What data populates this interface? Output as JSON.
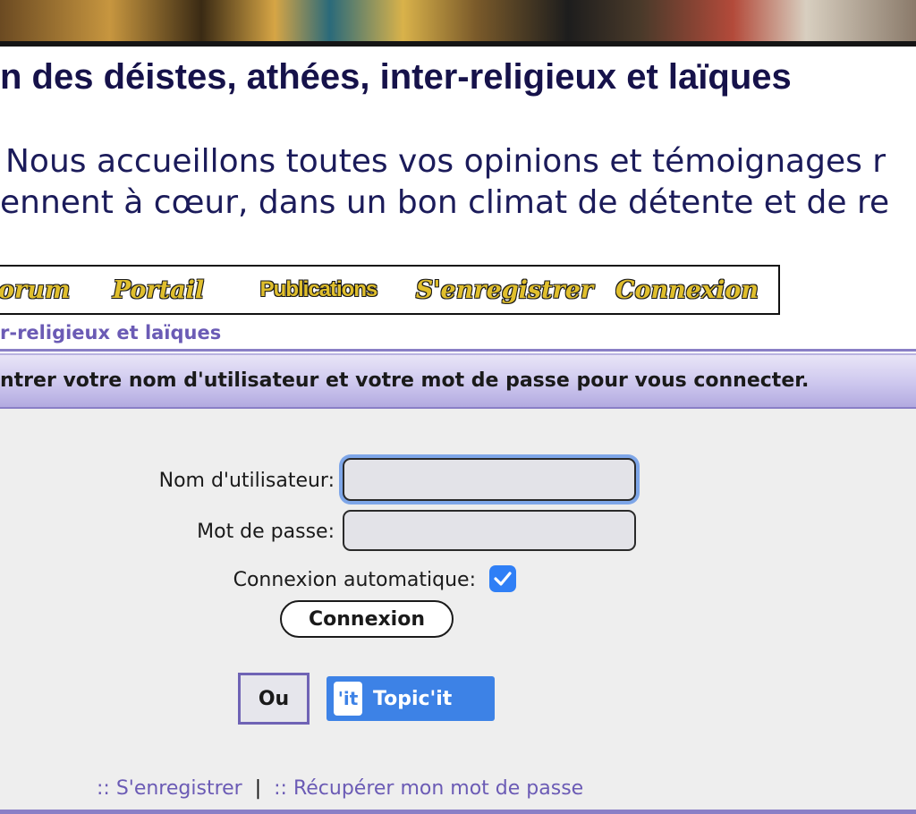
{
  "site": {
    "title": "n des déistes, athées, inter-religieux et laïques",
    "intro_line1": "Nous accueillons toutes vos opinions et témoignages r",
    "intro_line2": "ennent à cœur, dans un bon climat de détente et de re"
  },
  "nav": {
    "items": [
      {
        "label": "orum"
      },
      {
        "label": "Portail"
      },
      {
        "label": "Publications"
      },
      {
        "label": "S'enregistrer"
      },
      {
        "label": "Connexion"
      }
    ]
  },
  "breadcrumb": "r-religieux et laïques",
  "login": {
    "header": "ntrer votre nom d'utilisateur et votre mot de passe pour vous connecter.",
    "username_label": "Nom d'utilisateur:",
    "username_value": "",
    "password_label": "Mot de passe:",
    "password_value": "",
    "autologin_label": "Connexion automatique:",
    "autologin_checked": true,
    "submit_label": "Connexion",
    "or_label": "Ou",
    "topicit_logo": "'it",
    "topicit_label": "Topic'it"
  },
  "footer": {
    "register_link": ":: S'enregistrer",
    "separator": "|",
    "recover_link": ":: Récupérer mon mot de passe"
  },
  "colors": {
    "accent": "#6b5bb5",
    "title": "#16124a",
    "checkbox": "#2f7ff6",
    "topicit": "#3d82e6"
  }
}
